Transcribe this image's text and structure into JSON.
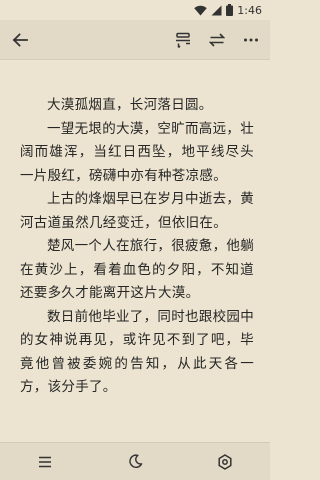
{
  "status_bar": {
    "time": "1:46",
    "icons": [
      "wifi-icon",
      "signal-icon",
      "battery-icon"
    ]
  },
  "toolbar": {
    "back_icon": "back-arrow-icon",
    "actions": [
      "bookmark-list-icon",
      "swap-icon",
      "more-icon"
    ]
  },
  "content": {
    "paragraphs": [
      "大漠孤烟直，长河落日圆。",
      "一望无垠的大漠，空旷而高远，壮阔而雄浑，当红日西坠，地平线尽头一片殷红，磅礴中亦有种苍凉感。",
      "上古的烽烟早已在岁月中逝去，黄河古道虽然几经变迁，但依旧在。",
      "楚风一个人在旅行，很疲惫，他躺在黄沙上，看着血色的夕阳，不知道还要多久才能离开这片大漠。",
      "数日前他毕业了，同时也跟校园中的女神说再见，或许见不到了吧，毕竟他曾被委婉的告知，从此天各一方，该分手了。"
    ]
  },
  "bottom_bar": {
    "actions": [
      "menu-icon",
      "night-mode-icon",
      "settings-icon"
    ]
  },
  "colors": {
    "background": "#ece4d0",
    "bars": "#e2dac6",
    "text": "#262626"
  }
}
